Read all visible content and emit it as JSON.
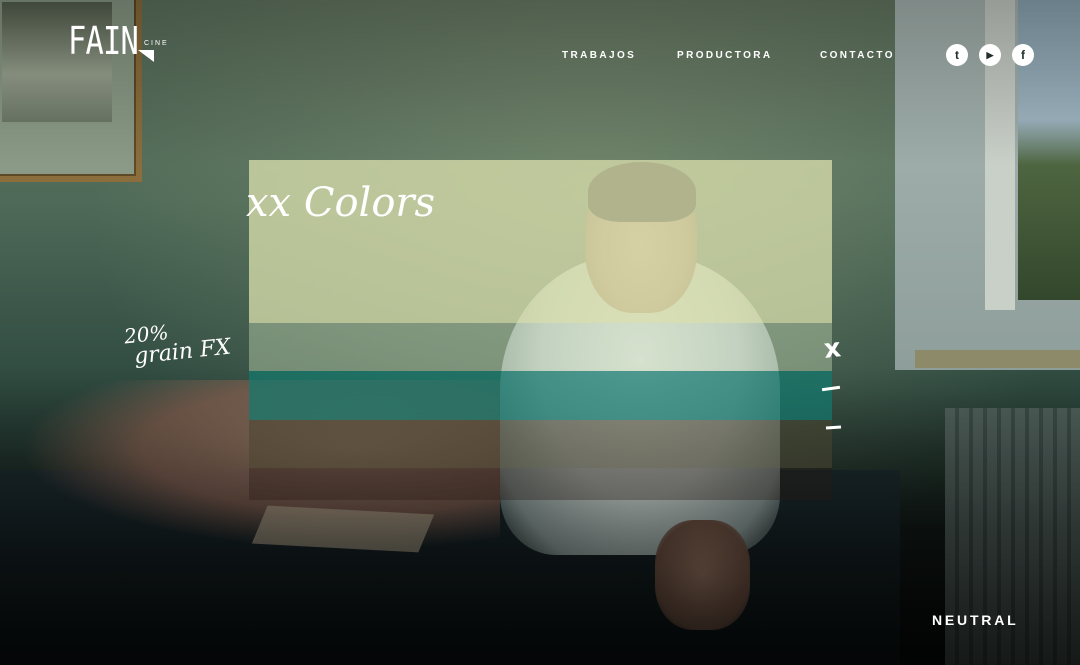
{
  "logo": {
    "main": "FAIN",
    "sub": "CINE"
  },
  "nav": {
    "items": [
      {
        "label": "TRABAJOS"
      },
      {
        "label": "PRODUCTORA"
      },
      {
        "label": "CONTACTO"
      }
    ]
  },
  "social": {
    "items": [
      {
        "name": "twitter-icon",
        "glyph": "t"
      },
      {
        "name": "youtube-icon",
        "glyph": "▶"
      },
      {
        "name": "facebook-icon",
        "glyph": "f"
      }
    ]
  },
  "annotations": {
    "colors": "xx Colors",
    "grain_line1": "20%",
    "grain_line2": "grain FX"
  },
  "tools": {
    "close": "x"
  },
  "swatches": [
    {
      "color": "rgba(214,220,170,0.78)"
    },
    {
      "color": "rgba(190,210,175,0.45)"
    },
    {
      "color": "rgba(20,120,110,0.72)"
    },
    {
      "color": "rgba(75,70,50,0.55)"
    },
    {
      "color": "rgba(40,25,20,0.35)"
    }
  ],
  "mode_label": "NEUTRAL"
}
